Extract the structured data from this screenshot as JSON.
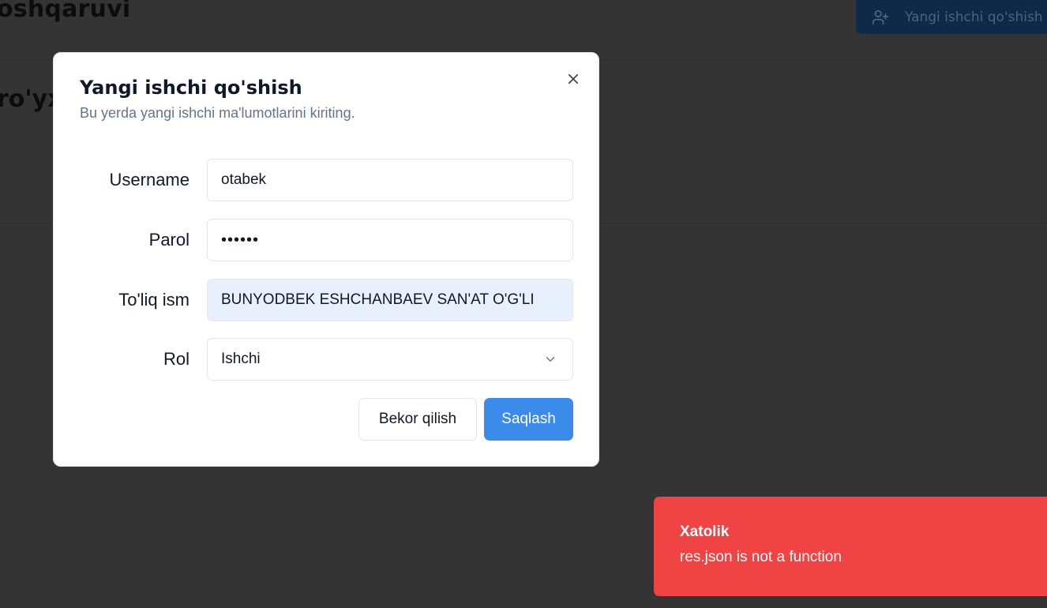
{
  "background": {
    "header_title": "oshqaruvi",
    "add_button_label": "Yangi ishchi qo'shish",
    "section_title": "ro'yx"
  },
  "modal": {
    "title": "Yangi ishchi qo'shish",
    "subtitle": "Bu yerda yangi ishchi ma'lumotlarini kiriting.",
    "fields": {
      "username": {
        "label": "Username",
        "value": "otabek"
      },
      "password": {
        "label": "Parol",
        "value": "otabek"
      },
      "full_name": {
        "label": "To'liq ism",
        "value": "BUNYODBEK ESHCHANBAEV SAN'AT O'G'LI"
      },
      "role": {
        "label": "Rol",
        "value": "Ishchi"
      }
    },
    "cancel_label": "Bekor qilish",
    "save_label": "Saqlash"
  },
  "toast": {
    "title": "Xatolik",
    "message": "res.json is not a function"
  },
  "colors": {
    "overlay": "#343434",
    "primary": "#3b8cea",
    "error": "#ef4344",
    "autofill": "#e8effd"
  }
}
